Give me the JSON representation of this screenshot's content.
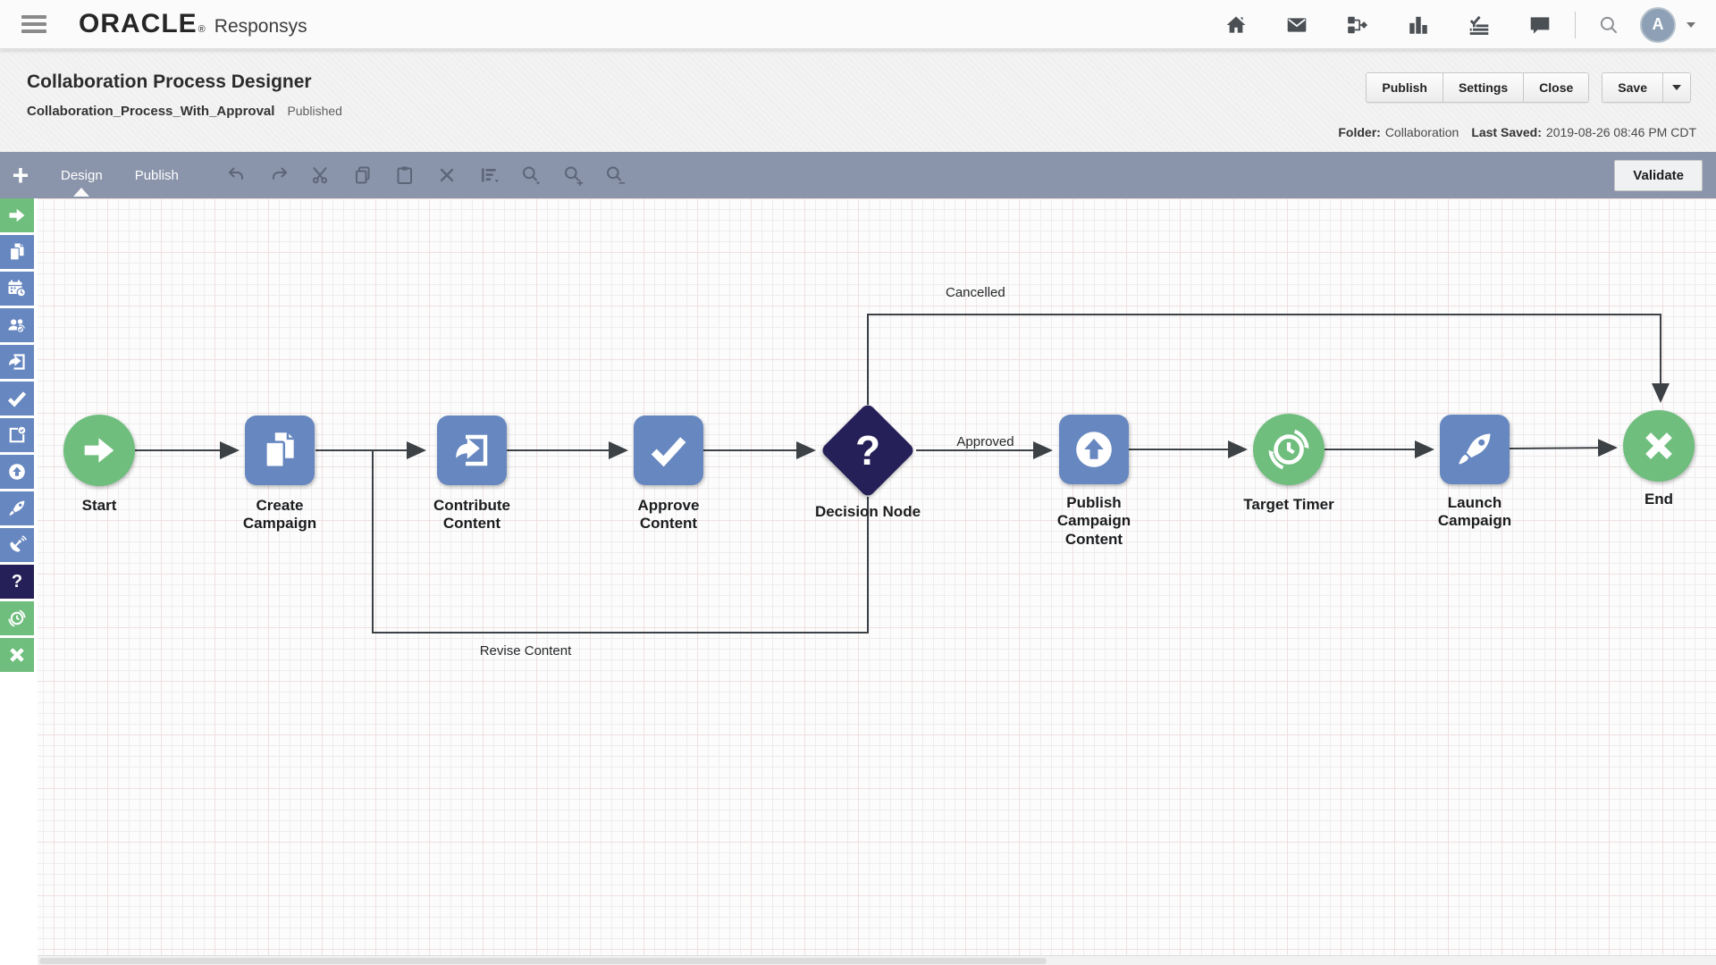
{
  "colors": {
    "toolbar": "#8a94aa",
    "node_blue": "#6787c0",
    "node_green": "#6fbe7d",
    "node_navy": "#262058",
    "edge": "#3c4146"
  },
  "header": {
    "brand": "ORACLE",
    "brand_reg": "®",
    "product": "Responsys",
    "icons": [
      "home-icon",
      "mail-icon",
      "program-icon",
      "analytics-icon",
      "tasks-icon",
      "chat-icon",
      "search-icon"
    ],
    "avatar_letter": "A"
  },
  "page": {
    "title": "Collaboration Process Designer",
    "doc_name": "Collaboration_Process_With_Approval",
    "status": "Published",
    "buttons": [
      "Publish",
      "Settings",
      "Close"
    ],
    "save_label": "Save",
    "folder_label": "Folder:",
    "folder_value": "Collaboration",
    "last_saved_label": "Last Saved:",
    "last_saved_value": "2019-08-26 08:46 PM CDT"
  },
  "toolbar": {
    "add_label": "+",
    "tabs": [
      {
        "label": "Design",
        "active": true
      },
      {
        "label": "Publish",
        "active": false
      }
    ],
    "icons": [
      "undo-icon",
      "redo-icon",
      "cut-icon",
      "copy-icon",
      "paste-icon",
      "delete-icon",
      "align-icon",
      "zoom-select-icon",
      "zoom-in-icon",
      "zoom-out-icon"
    ],
    "validate_label": "Validate"
  },
  "palette": {
    "question_glyph": "?",
    "items": [
      {
        "name": "start-arrow",
        "color": "#6fbe7d"
      },
      {
        "name": "create-campaign",
        "color": "#6787c0"
      },
      {
        "name": "schedule",
        "color": "#6787c0"
      },
      {
        "name": "team-approval",
        "color": "#6787c0"
      },
      {
        "name": "contribute-content",
        "color": "#6787c0"
      },
      {
        "name": "approve-content",
        "color": "#6787c0"
      },
      {
        "name": "review-document",
        "color": "#6787c0"
      },
      {
        "name": "publish-content",
        "color": "#6787c0"
      },
      {
        "name": "launch-campaign",
        "color": "#6787c0"
      },
      {
        "name": "broadcast",
        "color": "#6787c0"
      },
      {
        "name": "decision",
        "color": "#262058"
      },
      {
        "name": "timer",
        "color": "#6fbe7d"
      },
      {
        "name": "end",
        "color": "#6fbe7d"
      }
    ]
  },
  "flow": {
    "nodes": [
      {
        "id": "start",
        "label": "Start",
        "shape": "circle",
        "color": "green"
      },
      {
        "id": "create-campaign",
        "label": "Create\nCampaign",
        "shape": "square",
        "color": "blue"
      },
      {
        "id": "contribute-content",
        "label": "Contribute\nContent",
        "shape": "square",
        "color": "blue"
      },
      {
        "id": "approve-content",
        "label": "Approve\nContent",
        "shape": "square",
        "color": "blue"
      },
      {
        "id": "decision-node",
        "label": "Decision Node",
        "shape": "diamond",
        "color": "navy",
        "glyph": "?"
      },
      {
        "id": "publish-campaign-content",
        "label": "Publish\nCampaign\nContent",
        "shape": "square",
        "color": "blue"
      },
      {
        "id": "target-timer",
        "label": "Target Timer",
        "shape": "circle",
        "color": "green"
      },
      {
        "id": "launch-campaign",
        "label": "Launch\nCampaign",
        "shape": "square",
        "color": "blue"
      },
      {
        "id": "end",
        "label": "End",
        "shape": "circle",
        "color": "green"
      }
    ],
    "edge_labels": {
      "approved": "Approved",
      "cancelled": "Cancelled",
      "revise": "Revise Content"
    }
  }
}
